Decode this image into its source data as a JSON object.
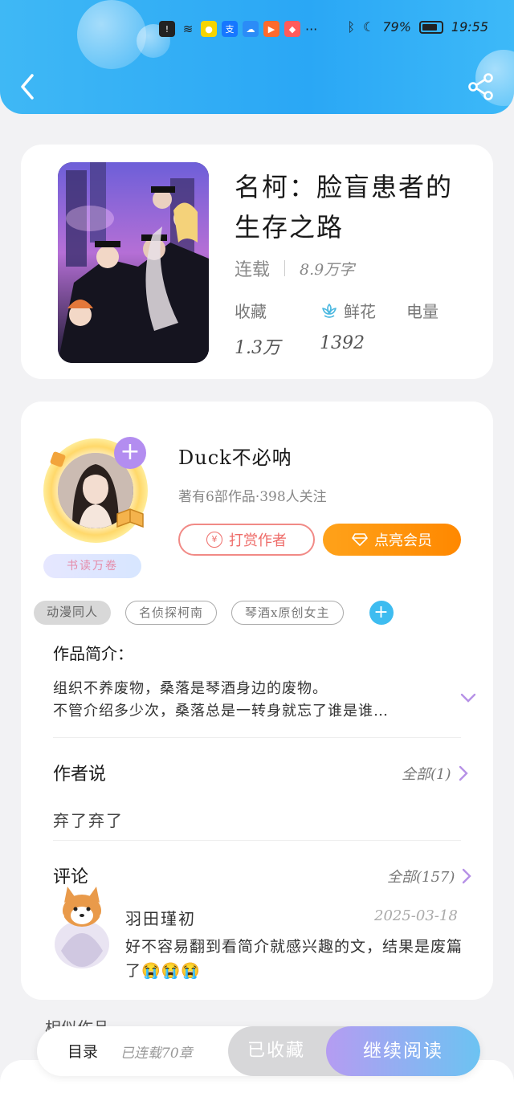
{
  "status_bar": {
    "battery": "79%",
    "time": "19:55",
    "more": "···"
  },
  "book": {
    "title": "名柯：脸盲患者的生存之路",
    "status": "连载",
    "word_count": "8.9万字",
    "stats": [
      {
        "label": "收藏",
        "value": "1.3万"
      },
      {
        "label": "鲜花",
        "value": "1392"
      },
      {
        "label": "电量",
        "value": ""
      }
    ]
  },
  "author": {
    "name": "Duck不必呐",
    "meta": "著有6部作品·398人关注",
    "badge": "书读万卷",
    "reward_label": "打赏作者",
    "vip_label": "点亮会员",
    "tags": [
      "动漫同人",
      "名侦探柯南",
      "琴酒x原创女主"
    ]
  },
  "intro": {
    "title": "作品简介：",
    "lines": [
      "组织不养废物，桑落是琴酒身边的废物。",
      "不管介绍多少次，桑落总是一转身就忘了谁是谁…"
    ]
  },
  "author_says": {
    "title": "作者说",
    "all_label": "全部(1)",
    "text": "弃了弃了"
  },
  "comments": {
    "title": "评论",
    "all_label": "全部(157)",
    "items": [
      {
        "user": "羽田瑾初",
        "date": "2025-03-18",
        "text": "好不容易翻到看简介就感兴趣的文，结果是废篇了😭😭😭"
      }
    ]
  },
  "related": {
    "title": "相似作品"
  },
  "bottom_bar": {
    "toc": "目录",
    "chapters": "已连载70章",
    "collected": "已收藏",
    "continue": "继续阅读"
  },
  "colors": {
    "header_blue": "#2aa7f5",
    "vip_orange": "#ff8800",
    "reward_red": "#ee6c69",
    "accent_purple": "#b38df0"
  }
}
